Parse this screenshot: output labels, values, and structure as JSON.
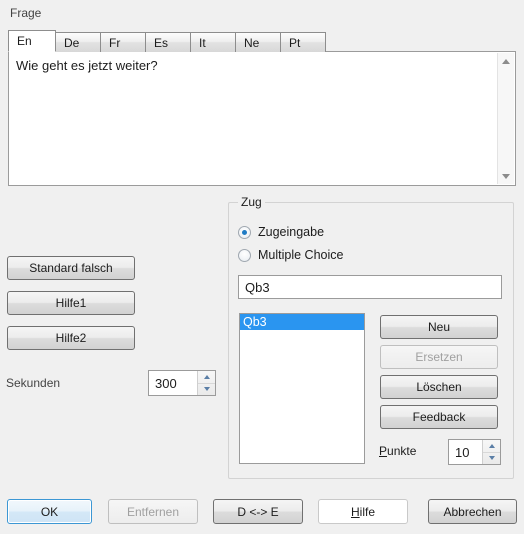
{
  "window": {
    "question_group_label": "Frage"
  },
  "language_tabs": {
    "active_index": 0,
    "items": [
      {
        "label": "En"
      },
      {
        "label": "De"
      },
      {
        "label": "Fr"
      },
      {
        "label": "Es"
      },
      {
        "label": "It"
      },
      {
        "label": "Ne"
      },
      {
        "label": "Pt"
      }
    ]
  },
  "question_editor": {
    "text": "Wie geht es jetzt weiter?",
    "scroll_up_icon": "triangle-up-icon",
    "scroll_down_icon": "triangle-down-icon"
  },
  "left_panel": {
    "standard_falsch_label": "Standard falsch",
    "hilfe1_label": "Hilfe1",
    "hilfe2_label": "Hilfe2",
    "sekunden_label": "Sekunden",
    "sekunden_value": "300"
  },
  "zug": {
    "group_label": "Zug",
    "radio_zugeingabe_label": "Zugeingabe",
    "radio_multiple_choice_label": "Multiple Choice",
    "selected_mode": "Zugeingabe",
    "move_input_value": "Qb3",
    "move_input_placeholder": "",
    "moves_list": [
      {
        "label": "Qb3",
        "selected": true
      }
    ],
    "neu_label": "Neu",
    "ersetzen_label": "Ersetzen",
    "ersetzen_enabled": false,
    "loeschen_label": "Löschen",
    "feedback_label": "Feedback",
    "punkte_label_mnemonic": "P",
    "punkte_label_rest": "unkte",
    "punkte_value": "10"
  },
  "bottom_bar": {
    "ok_label": "OK",
    "entfernen_label": "Entfernen",
    "entfernen_enabled": false,
    "swap_label": "D <-> E",
    "hilfe_label_mnemonic": "H",
    "hilfe_label_rest": "ilfe",
    "abbrechen_label": "Abbrechen"
  },
  "colors": {
    "window_background": "#f0f0f0",
    "selection_blue": "#2a95f0",
    "focus_blue": "#3c97d4",
    "radio_dot": "#1f7bc4",
    "disabled_text": "#a0a0a0"
  }
}
